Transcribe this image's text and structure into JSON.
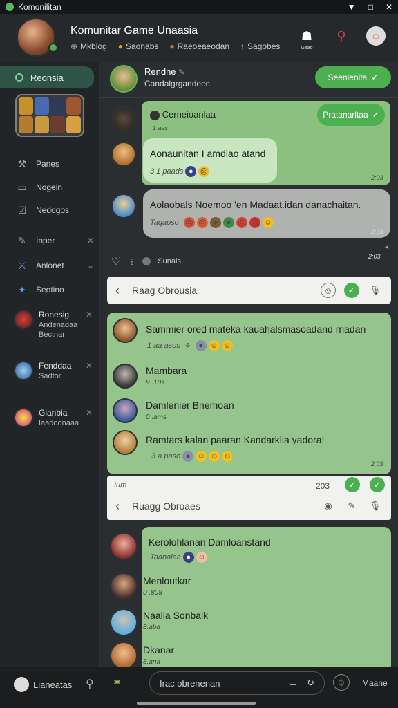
{
  "titlebar": {
    "title": "Komonilitan",
    "min": "▼",
    "max": "□",
    "close": "✕"
  },
  "header": {
    "title": "Komunitar Game Unaasia",
    "sub": [
      {
        "icon": "globe-icon",
        "glyph": "⊕",
        "label": "Mkblog"
      },
      {
        "icon": "badge-icon",
        "glyph": "●",
        "label": "Saonabs"
      },
      {
        "icon": "fire-icon",
        "glyph": "●",
        "label": "Raeoeaeodan"
      },
      {
        "icon": "pin-icon",
        "glyph": "↑",
        "label": "Sagobes"
      }
    ],
    "btn_label": "Gaao"
  },
  "sidebar": {
    "top_label": "Reonsia",
    "nav": [
      {
        "icon": "hammer-icon",
        "glyph": "⚒",
        "label": "Panes"
      },
      {
        "icon": "chat-icon",
        "glyph": "▭",
        "label": "Nogein"
      },
      {
        "icon": "check-box-icon",
        "glyph": "☑",
        "label": "Nedogos"
      },
      {
        "icon": "feather-icon",
        "glyph": "✎",
        "label": "Inper",
        "close": "✕"
      },
      {
        "icon": "swords-icon",
        "glyph": "⚔",
        "label": "Anlonet",
        "close": "⌄"
      },
      {
        "icon": "shield-icon",
        "glyph": "✦",
        "label": "Seotino"
      }
    ],
    "contacts": [
      {
        "name": "Ronesig",
        "sub": "Andenadaa",
        "sub2": "Bectnar",
        "close": "✕"
      },
      {
        "name": "Fenddaa",
        "sub": "Sadtor",
        "close": "✕"
      },
      {
        "name": "Gianbia",
        "sub": "Iaadoonaaa",
        "close": "✕"
      }
    ]
  },
  "chat": {
    "header_name": "Rendne",
    "header_edit": "✎",
    "header_sub": "Candalgrgandeoc",
    "join_button": "Seenlenita",
    "card1": {
      "author": "Cerneioanlaa",
      "author_time": "1 aes",
      "pill": "Pratanarltaa",
      "bubble_text": "Aonaunitan I amdiao atand",
      "bubble_meta": "3 1 paads",
      "bubble_time": "2:03"
    },
    "msg2": {
      "text": "Aolaobals Noemoo 'en Madaat.idan danachaitan.",
      "meta": "Taqaoso",
      "time": "2:03"
    },
    "reactions_label": "Sunals",
    "time3": "2:03",
    "input1_placeholder": "Raag Obrousia",
    "card2": {
      "m1_text": "Sammier ored mateka kauahalsmasoadand rnadan",
      "m1_meta": "1 aa asos",
      "m2_name": "Mambara",
      "m2_time": "9 .10s",
      "m3_name": "Damlenier Bnemoan",
      "m3_time": "0 .ams",
      "m4_text": "Ramtars kalan paaran Kandarklia yadora!",
      "m4_meta": "3 a paso",
      "m4_time": "2:03"
    },
    "strip_left": "Ium",
    "strip_right": "203",
    "input2_placeholder": "Ruagg Obroaes",
    "card3": {
      "m1_name": "Kerolohlanan Damloanstand",
      "m1_meta": "Taanalaa",
      "m2_name": "Menloutkar",
      "m2_time": "0 .808",
      "m3_name": "Naalia Sonbalk",
      "m3_time": "8.aba",
      "m4_name": "Dkanar",
      "m4_time": "8.ana"
    }
  },
  "bottombar": {
    "left_label": "Lianeatas",
    "input_placeholder": "Irac obrenenan",
    "right_label": "Maane"
  },
  "colors": {
    "accent": "#4caf50",
    "card": "#95c48c",
    "bg": "#2b2e30"
  }
}
